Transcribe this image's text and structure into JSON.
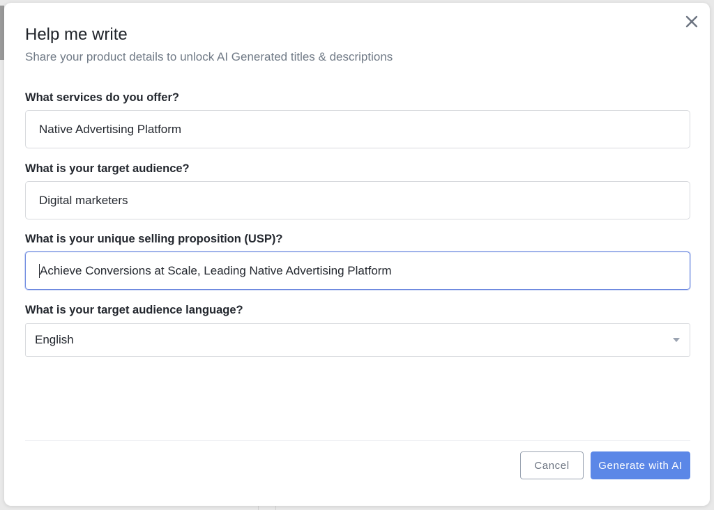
{
  "modal": {
    "title": "Help me write",
    "subtitle": "Share your product details to unlock AI Generated titles & descriptions",
    "close_icon": "close-icon"
  },
  "fields": {
    "services": {
      "label": "What services do you offer?",
      "value": "Native Advertising Platform"
    },
    "audience": {
      "label": "What is your target audience?",
      "value": "Digital marketers"
    },
    "usp": {
      "label": "What is your unique selling proposition (USP)?",
      "value": "Achieve Conversions at Scale, Leading Native Advertising Platform",
      "focused": true
    },
    "language": {
      "label": "What is your target audience language?",
      "value": "English",
      "arrow_icon": "chevron-down-icon"
    }
  },
  "footer": {
    "cancel_label": "Cancel",
    "generate_label": "Generate with AI"
  },
  "colors": {
    "primary": "#5b87e7",
    "focus_border": "#6e8ae0",
    "title_text": "#1f2329",
    "subtitle_text": "#707a86"
  }
}
